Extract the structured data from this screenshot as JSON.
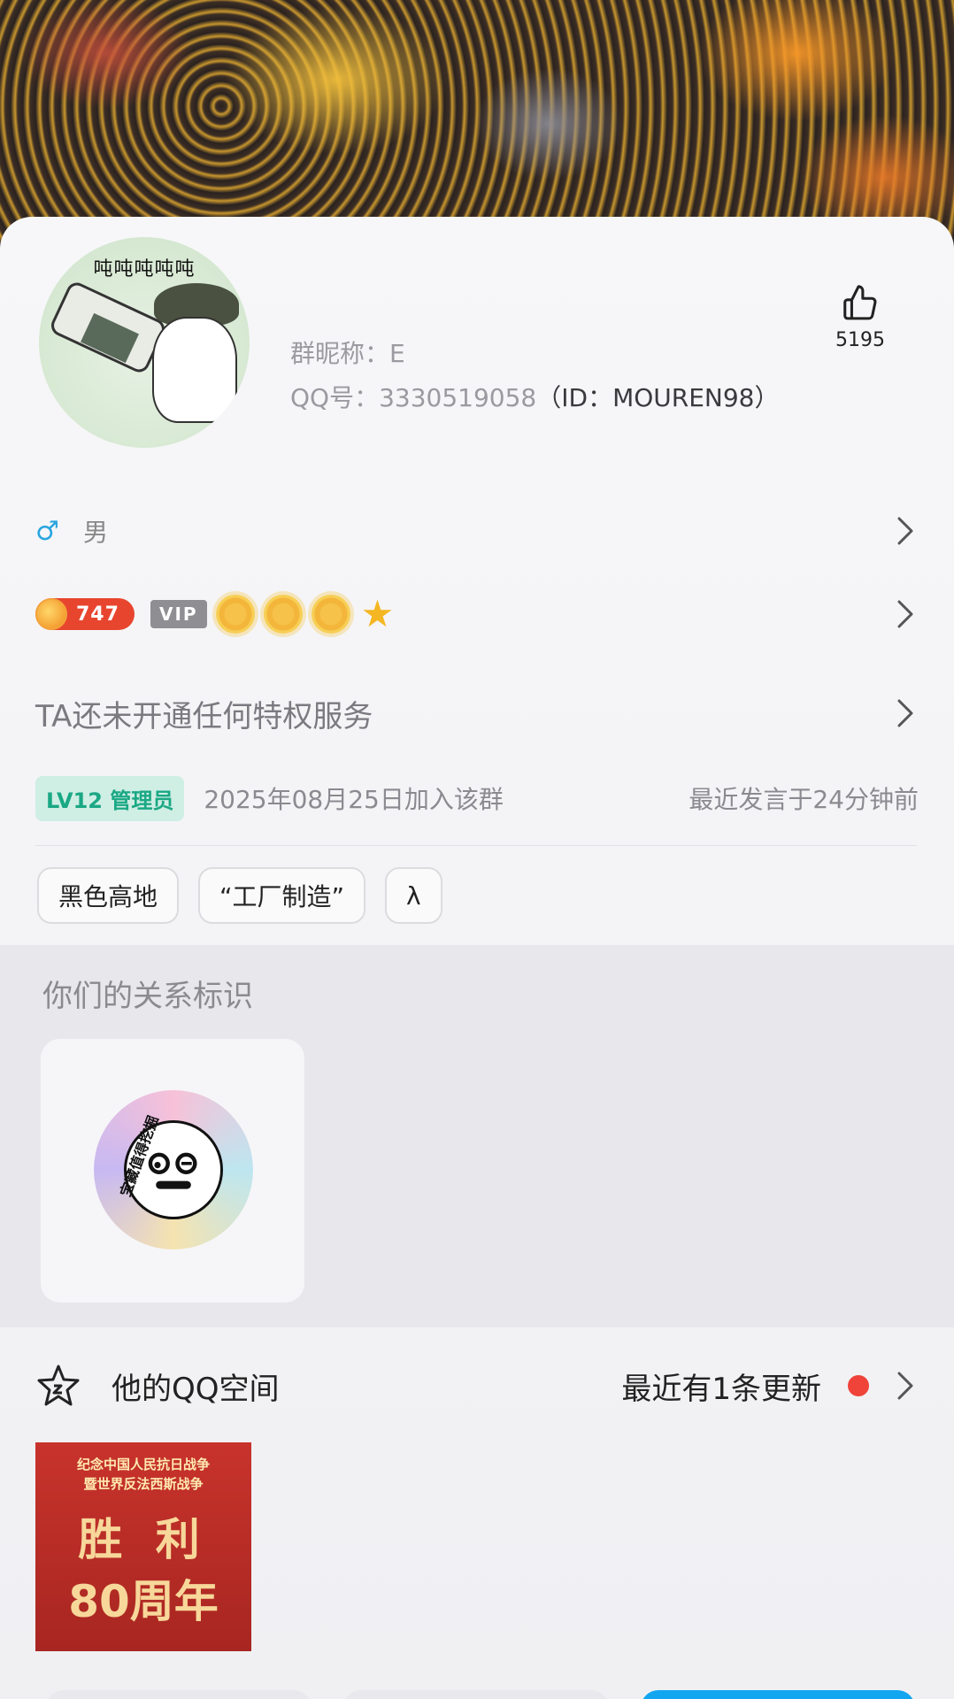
{
  "profile": {
    "avatar_caption": "吨吨吨吨吨",
    "group_nickname": "群昵称：E",
    "qq_prefix": "QQ号：",
    "qq_number": "3330519058",
    "uid": "（ID：MOUREN98）",
    "likes": "5195",
    "gender": "男"
  },
  "level": {
    "value": "747",
    "vip": "VIP"
  },
  "privilege_text": "TA还未开通任何特权服务",
  "group": {
    "lv_badge": "LV12 管理员",
    "join_date": "2025年08月25日加入该群",
    "last_speak": "最近发言于24分钟前"
  },
  "tags": [
    "黑色高地",
    "“工厂制造”",
    "λ"
  ],
  "relation": {
    "title": "你们的关系标识",
    "medal_text": "宝藏值得挖掘"
  },
  "qzone": {
    "title": "他的QQ空间",
    "update": "最近有1条更新",
    "thumb_line1": "纪念中国人民抗日战争",
    "thumb_line2": "暨世界反法西斯战争",
    "thumb_big1": "胜 利",
    "thumb_big2": "80周年"
  },
  "colors": {
    "accent_blue": "#2aa5e0",
    "badge_green": "#1aa884",
    "red_dot": "#f0433a"
  },
  "icons": [
    "thumb-up-icon",
    "male-icon",
    "chevron-right-icon",
    "qzone-star-icon"
  ]
}
